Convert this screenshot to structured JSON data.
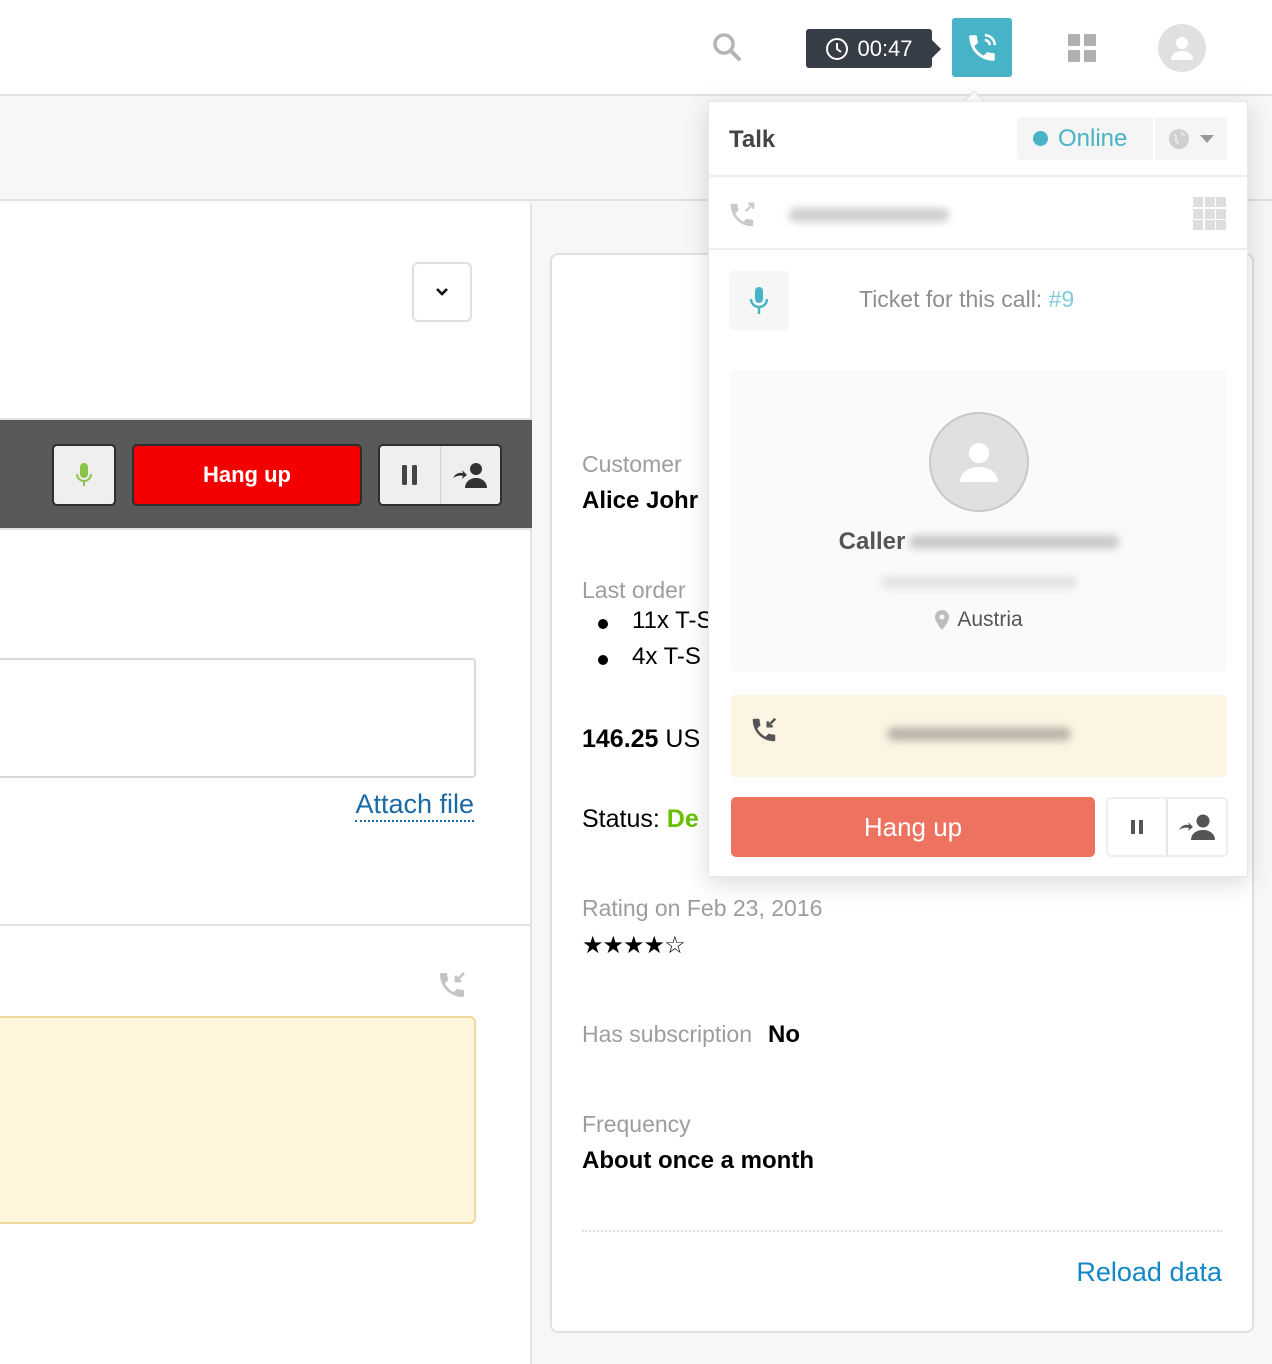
{
  "topbar": {
    "timer": "00:47",
    "icons": {
      "search": "search-icon",
      "timer": "clock-icon",
      "talk": "phone-ringing-icon",
      "apps": "apps-grid-icon",
      "profile": "user-avatar-icon"
    }
  },
  "left": {
    "call_bar": {
      "mute_icon": "microphone-icon",
      "hang_up_label": "Hang up",
      "hold_icon": "pause-icon",
      "transfer_icon": "transfer-user-icon"
    },
    "attach_file_label": "Attach file",
    "inbound_icon": "incoming-call-icon"
  },
  "customer_card": {
    "customer_label": "Customer",
    "customer_name": "Alice Johr",
    "last_order_label": "Last order",
    "last_order_items": [
      "11x T-S",
      "4x T-S"
    ],
    "order_total": "146.25",
    "order_currency": "US",
    "status_label": "Status:",
    "status_value": "De",
    "rating_label": "Rating on Feb 23, 2016",
    "rating": {
      "value": 4,
      "max": 5,
      "display": "★★★★☆"
    },
    "subscription_label": "Has subscription",
    "subscription_value": "No",
    "frequency_label": "Frequency",
    "frequency_value": "About once a month",
    "reload_label": "Reload data"
  },
  "talk_popover": {
    "title": "Talk",
    "status": "Online",
    "status_color": "#47b3c6",
    "ticket_prefix": "Ticket for this call:",
    "ticket_id": "#9",
    "caller_label": "Caller",
    "caller_location": "Austria",
    "hang_up_label": "Hang up",
    "hang_up_color": "#ee7260"
  },
  "colors": {
    "accent": "#47b3c6",
    "legacy_hangup": "#f40000",
    "status_green": "#66c100",
    "link_blue": "#1387c8"
  }
}
